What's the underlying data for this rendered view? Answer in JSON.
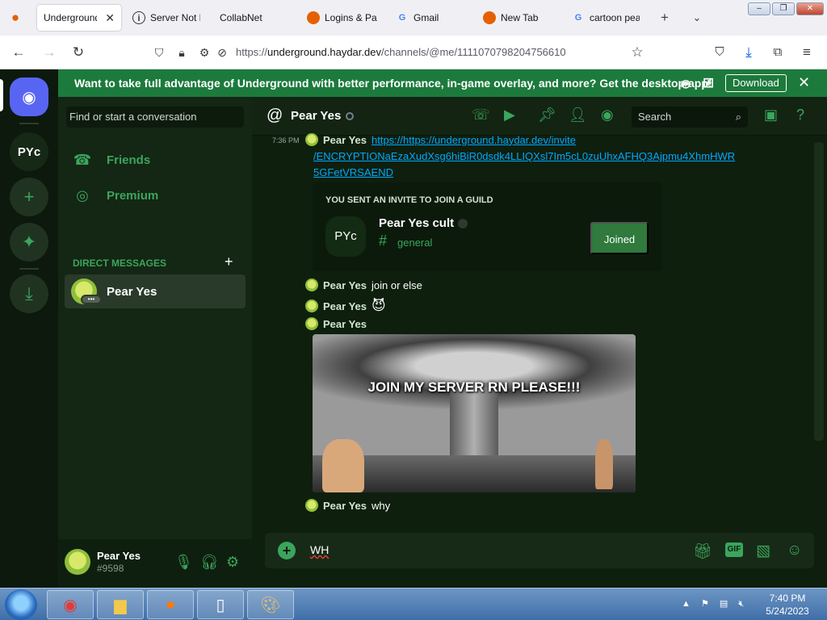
{
  "browser": {
    "tabs": [
      {
        "label": "Underground",
        "active": true
      },
      {
        "label": "Server Not F"
      },
      {
        "label": "CollabNet"
      },
      {
        "label": "Logins & Pa"
      },
      {
        "label": "Gmail"
      },
      {
        "label": "New Tab"
      },
      {
        "label": "cartoon pea"
      }
    ],
    "url_prefix": "https://",
    "url_host": "underground.haydar.dev",
    "url_path": "/channels/@me/1111070798204756610"
  },
  "banner": {
    "message": "Want to take full advantage of Underground with better performance, in-game overlay, and more? Get the desktop app!",
    "download_label": "Download"
  },
  "rail": {
    "server_label": "PYc"
  },
  "dm": {
    "search_placeholder": "Find or start a conversation",
    "friends_label": "Friends",
    "premium_label": "Premium",
    "section_title": "DIRECT MESSAGES",
    "conversation_name": "Pear Yes",
    "typing_dots": "•••"
  },
  "user": {
    "name": "Pear Yes",
    "tag": "#9598"
  },
  "chat": {
    "header_name": "Pear Yes",
    "search_placeholder": "Search",
    "timestamp": "7:36 PM",
    "messages": [
      {
        "author": "Pear Yes",
        "text": "https://https://underground.haydar.dev/invite"
      },
      {
        "author": "Pear Yes",
        "text": "join  or else"
      },
      {
        "author": "Pear Yes",
        "text": "😈"
      },
      {
        "author": "Pear Yes",
        "text": ""
      },
      {
        "author": "Pear Yes",
        "text": "why"
      }
    ],
    "link_line2": "/ENCRYPTIONaEzaXudXsg6hiBiR0dsdk4LLIQXsl7Im5cL0zuUhxAFHQ3Ajpmu4XhmHWR",
    "link_line3": "5GFetVRSAEND",
    "invite": {
      "label": "YOU SENT AN INVITE TO JOIN A GUILD",
      "guild_icon": "PYc",
      "guild_name": "Pear Yes cult",
      "channel": "general",
      "button": "Joined"
    },
    "gif_caption": "JOIN MY SERVER RN PLEASE!!!",
    "composer_value": "WH"
  },
  "taskbar": {
    "time": "7:40 PM",
    "date": "5/24/2023"
  },
  "colors": {
    "accent": "#3ba55d",
    "banner": "#1c7a3c",
    "link": "#00a8fc",
    "blurple": "#5865f2"
  }
}
